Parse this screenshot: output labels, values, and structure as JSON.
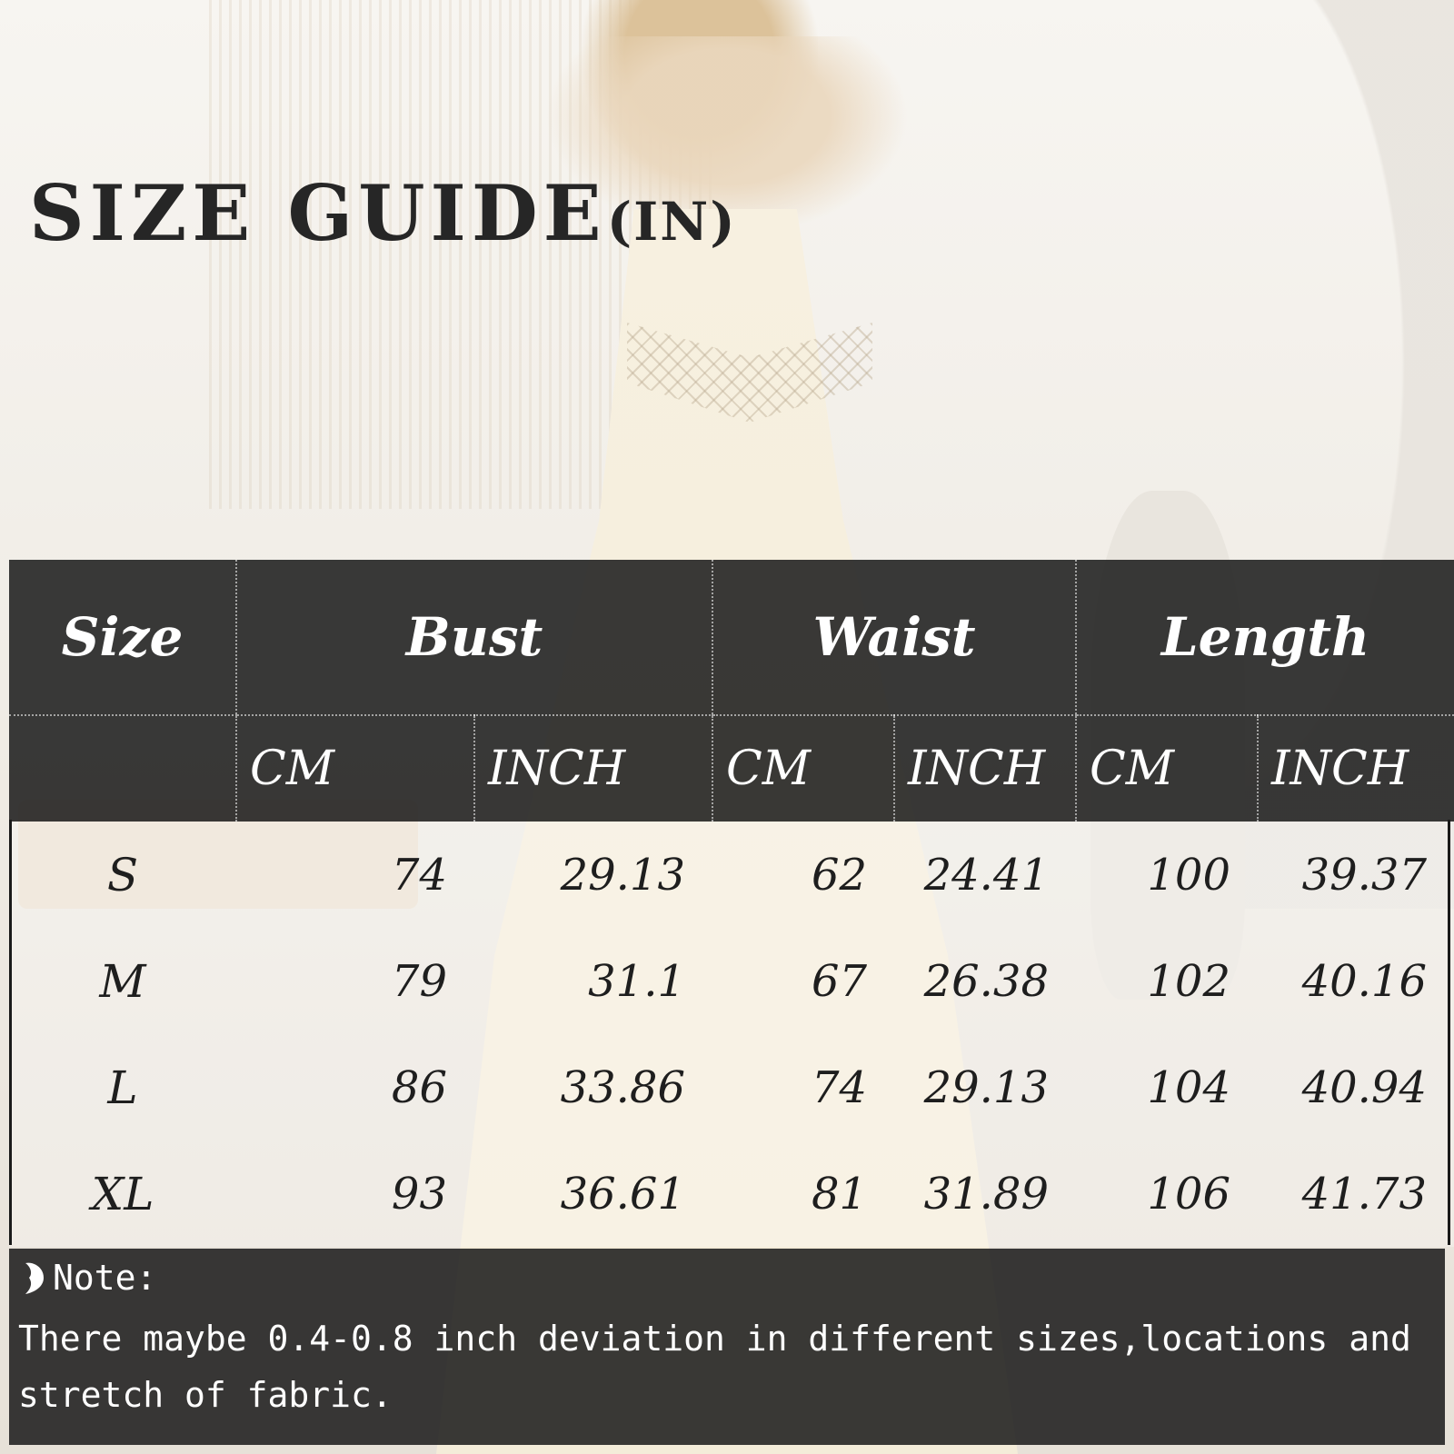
{
  "title": {
    "main": "SIZE GUIDE",
    "unit": "(IN)"
  },
  "table": {
    "groups": [
      "Size",
      "Bust",
      "Waist",
      "Length"
    ],
    "subheaders": [
      "CM",
      "INCH",
      "CM",
      "INCH",
      "CM",
      "INCH"
    ],
    "rows": [
      {
        "size": "S",
        "bust_cm": "74",
        "bust_in": "29.13",
        "waist_cm": "62",
        "waist_in": "24.41",
        "length_cm": "100",
        "length_in": "39.37"
      },
      {
        "size": "M",
        "bust_cm": "79",
        "bust_in": "31.1",
        "waist_cm": "67",
        "waist_in": "26.38",
        "length_cm": "102",
        "length_in": "40.16"
      },
      {
        "size": "L",
        "bust_cm": "86",
        "bust_in": "33.86",
        "waist_cm": "74",
        "waist_in": "29.13",
        "length_cm": "104",
        "length_in": "40.94"
      },
      {
        "size": "XL",
        "bust_cm": "93",
        "bust_in": "36.61",
        "waist_cm": "81",
        "waist_in": "31.89",
        "length_cm": "106",
        "length_in": "41.73"
      }
    ]
  },
  "note": {
    "label": "Note:",
    "text": "There maybe 0.4-0.8 inch deviation in different sizes,locations and stretch of fabric.",
    "icon": "heart-icon"
  },
  "colors": {
    "header_bg": "#1a1a1a",
    "header_text": "#ffffff",
    "body_text": "#1e1e1e"
  }
}
